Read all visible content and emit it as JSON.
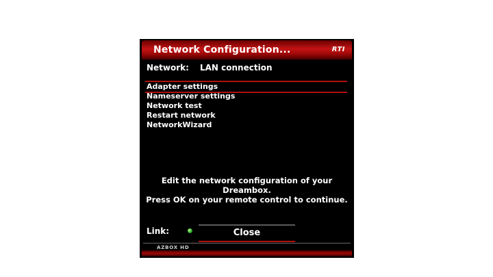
{
  "window": {
    "title": "Network Configuration...",
    "logo": "RTI"
  },
  "network": {
    "label": "Network:",
    "value": "LAN connection"
  },
  "menu": {
    "items": [
      {
        "label": "Adapter settings",
        "selected": true
      },
      {
        "label": "Nameserver settings",
        "selected": false
      },
      {
        "label": "Network test",
        "selected": false
      },
      {
        "label": "Restart network",
        "selected": false
      },
      {
        "label": "NetworkWizard",
        "selected": false
      }
    ]
  },
  "info": {
    "line1": "Edit the network configuration of your",
    "line2": "Dreambox.",
    "line3": "Press OK on your remote control to continue."
  },
  "link": {
    "label": "Link:",
    "status_color": "#2aa12a"
  },
  "buttons": {
    "close_label": "Close"
  },
  "footer": {
    "brand": "AZBOX HD"
  },
  "colors": {
    "accent": "#b01010",
    "background": "#000000"
  }
}
